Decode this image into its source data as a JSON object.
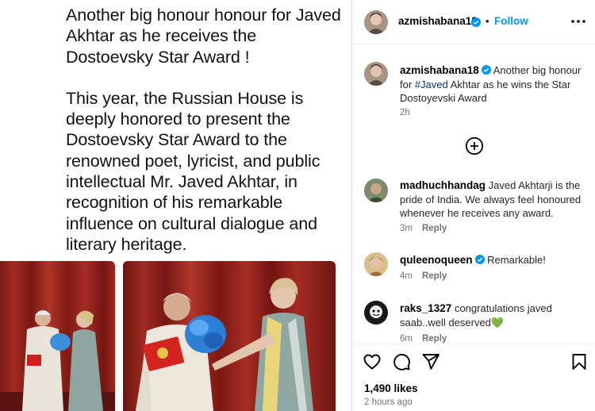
{
  "post": {
    "heading": "Another big honour honour for Javed Akhtar as he receives  the Dostoevsky Star Award !",
    "body": "This year, the Russian House is deeply honored to present the Dostoevsky Star Award to the renowned poet, lyricist, and public intellectual Mr. Javed Akhtar, in recognition of his remarkable influence on cultural dialogue and literary heritage."
  },
  "header": {
    "username": "azmishabana18",
    "separator": "•",
    "follow_label": "Follow",
    "more_icon": "more-options-icon"
  },
  "caption": {
    "username": "azmishabana18",
    "text_before": "Another big honour for ",
    "hashtag": "#Javed",
    "text_after": " Akhtar as he wins the Star Dostoyevski Award",
    "time": "2h"
  },
  "add_icon": "plus-circle-icon",
  "comments": [
    {
      "username": "madhuchhandag",
      "text": "Javed Akhtarji is the pride of India. We always feel honoured whenever he receives any award.",
      "time": "3m",
      "reply": "Reply"
    },
    {
      "username": "quleenoqueen",
      "text": "Remarkable!",
      "time": "4m",
      "reply": "Reply"
    },
    {
      "username": "raks_1327",
      "text": "congratulations javed saab..well deserved💚",
      "time": "6m",
      "reply": "Reply"
    }
  ],
  "actions": {
    "like_icon": "heart-icon",
    "comment_icon": "comment-icon",
    "share_icon": "send-icon",
    "save_icon": "bookmark-icon"
  },
  "likes": "1,490 likes",
  "posted_ago": "2 hours ago",
  "colors": {
    "link_blue": "#0095f6",
    "hashtag": "#00376b",
    "muted": "#737373",
    "curtain_red": "#8e1d1a"
  }
}
